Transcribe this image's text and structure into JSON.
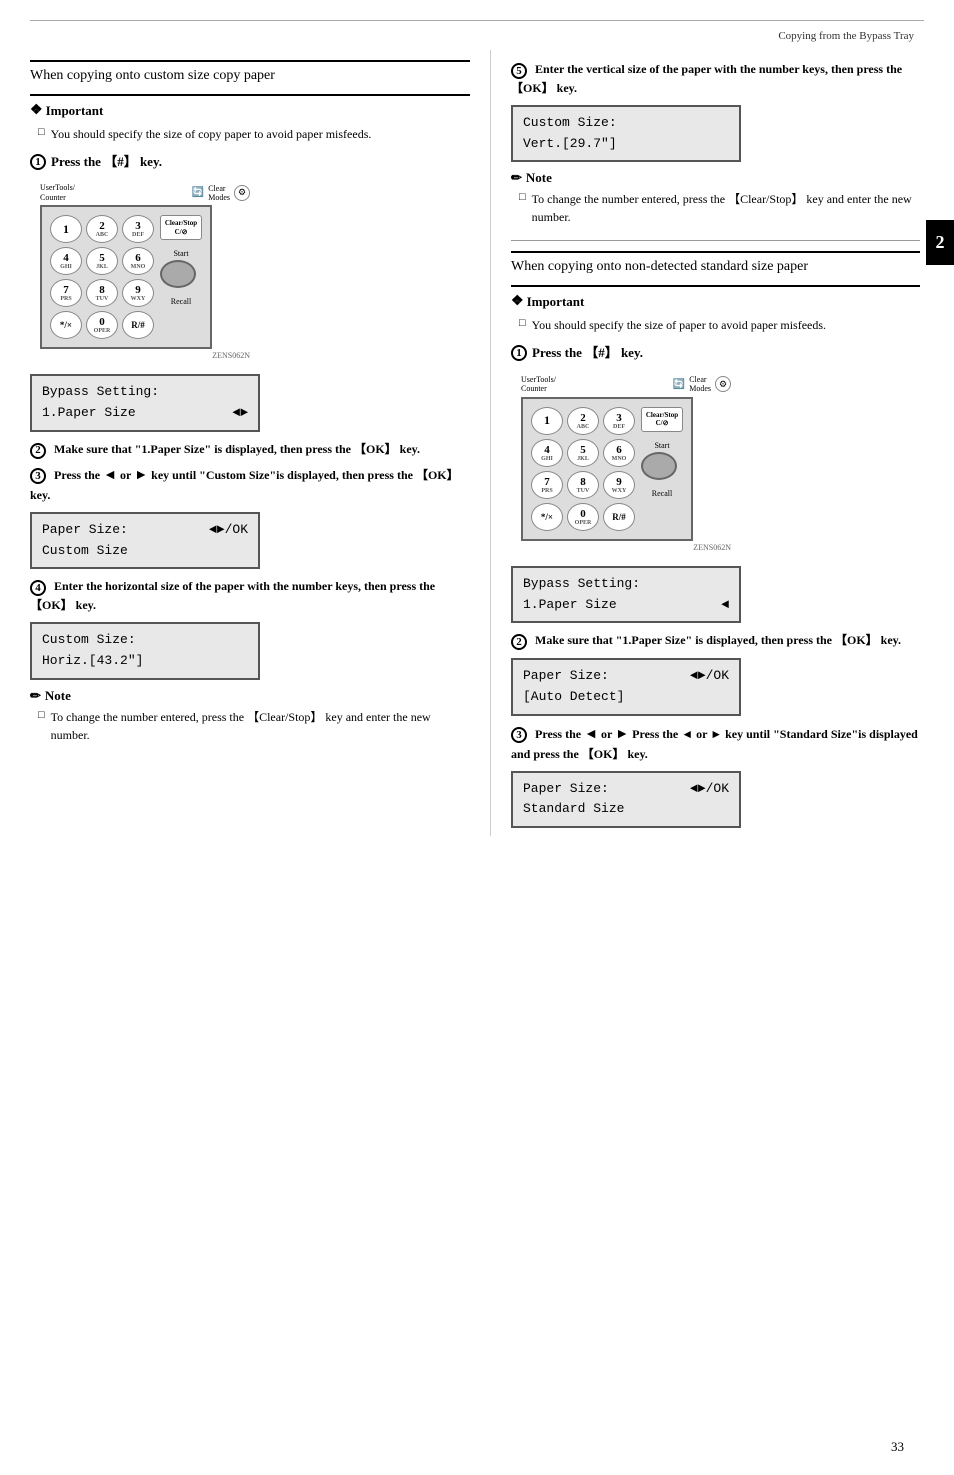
{
  "header": {
    "title": "Copying from the Bypass Tray",
    "page_number": "33",
    "chapter_tab": "2"
  },
  "left_section": {
    "title": "When copying onto custom size copy paper",
    "important": {
      "label": "Important",
      "items": [
        "You should specify the size of copy paper to avoid paper misfeeds."
      ]
    },
    "step1": {
      "number": "1",
      "text": "Press the 【#】 key."
    },
    "step2": {
      "number": "2",
      "text": "Make sure that \"1.Paper Size\" is displayed, then press the 【OK】 key."
    },
    "lcd1": {
      "line1": "Bypass Setting:",
      "line2": "1.Paper Size",
      "arrow": "◄►"
    },
    "step3": {
      "number": "3",
      "text": "Press the ◄ or ► key until \"Custom Size\"is displayed, then press the 【OK】 key."
    },
    "lcd2": {
      "line1": "Paper Size:",
      "line1_right": "◄►/OK",
      "line2": "Custom Size"
    },
    "step4": {
      "number": "4",
      "text": "Enter the horizontal size of the paper with the number keys, then press the 【OK】 key."
    },
    "lcd3": {
      "line1": "Custom Size:",
      "line2": "Horiz.[43.2\"]"
    },
    "note1": {
      "label": "Note",
      "items": [
        "To change the number entered, press the 【Clear/Stop】 key and enter the new number."
      ]
    }
  },
  "right_section": {
    "step5": {
      "number": "5",
      "text": "Enter the vertical size of the paper with the number keys, then press the 【OK】 key."
    },
    "lcd4": {
      "line1": "Custom Size:",
      "line2": "Vert.[29.7\"]"
    },
    "note2": {
      "label": "Note",
      "items": [
        "To change the number entered, press the 【Clear/Stop】 key and enter the new number."
      ]
    },
    "section2_title": "When copying onto non-detected standard size paper",
    "important2": {
      "label": "Important",
      "items": [
        "You should specify the size of paper to avoid paper misfeeds."
      ]
    },
    "step1b": {
      "number": "1",
      "text": "Press the 【#】 key."
    },
    "step2b": {
      "number": "2",
      "text": "Make sure that \"1.Paper Size\" is displayed, then press the 【OK】 key."
    },
    "lcd5": {
      "line1": "Bypass Setting:",
      "line2": "1.Paper Size",
      "arrow": "◄"
    },
    "lcd6": {
      "line1": "Paper Size:",
      "line1_right": "◄►/OK",
      "line2": "[Auto Detect]"
    },
    "step3b": {
      "number": "3",
      "text": "Press the ◄ or ► key until \"Standard Size\"is displayed and press the 【OK】 key."
    },
    "lcd7": {
      "line1": "Paper Size:",
      "line1_right": "◄►/OK",
      "line2": "Standard Size"
    },
    "zens_label": "ZENS062N"
  },
  "keypad": {
    "top_left": "UserTools/ Counter",
    "top_right_icon": "Clear Modes",
    "keys": [
      {
        "label": "1",
        "sub": ""
      },
      {
        "label": "2",
        "sub": "ABC"
      },
      {
        "label": "3",
        "sub": "DEF"
      },
      {
        "label": "4",
        "sub": "GHI"
      },
      {
        "label": "5",
        "sub": "JKL"
      },
      {
        "label": "6",
        "sub": "MNO"
      },
      {
        "label": "7",
        "sub": "PRS"
      },
      {
        "label": "8",
        "sub": "TUV"
      },
      {
        "label": "9",
        "sub": "WXY"
      },
      {
        "label": "*/×",
        "sub": ""
      },
      {
        "label": "0",
        "sub": "OPER"
      },
      {
        "label": "R/#",
        "sub": ""
      }
    ],
    "clear_stop": "Clear/Stop C/⊘",
    "start": "Start",
    "recall": "Recall",
    "zens_label": "ZENS062N"
  }
}
